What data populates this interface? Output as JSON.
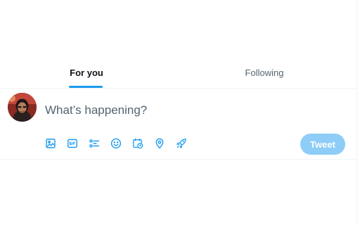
{
  "tabs": [
    {
      "label": "For you",
      "active": true
    },
    {
      "label": "Following",
      "active": false
    }
  ],
  "composer": {
    "placeholder": "What’s happening?",
    "value": "",
    "submit_label": "Tweet",
    "submit_enabled": false
  },
  "toolbar_icons": [
    "media-icon",
    "gif-icon",
    "poll-icon",
    "emoji-icon",
    "schedule-icon",
    "location-icon",
    "rocket-icon"
  ],
  "colors": {
    "accent": "#1d9bf0",
    "button_disabled": "#8ecdf7",
    "text_primary": "#0f1419",
    "text_secondary": "#536471",
    "divider": "#eff3f4"
  }
}
